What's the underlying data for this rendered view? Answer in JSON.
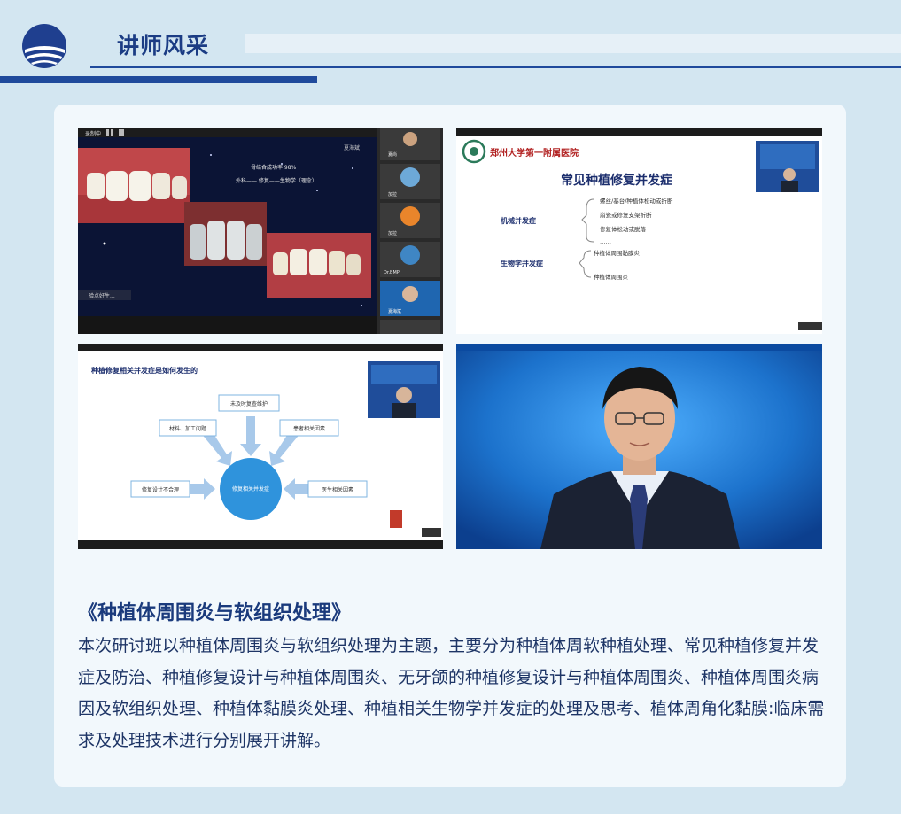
{
  "header": {
    "section_title": "讲师风采"
  },
  "screenshots": {
    "s1": {
      "recording_label": "录制中",
      "slide_line1": "骨结合成功率 98%",
      "slide_line2": "外科—— 修复——生物学（理念）",
      "author_stamp": "夏海斌",
      "caption": "验点好生...",
      "participants": [
        "夏尚",
        "加拉",
        "加拉",
        "Dr.BMP",
        "夏海斌"
      ]
    },
    "s2": {
      "hospital_name": "郑州大学第一附属医院",
      "slide_title": "常见种植修复并发症",
      "group1_label": "机械并发症",
      "group1_items": [
        "螺丝/基台/种植体松动或折断",
        "崩瓷或修复支架折断",
        "修复体松动或脱落",
        "……"
      ],
      "group2_label": "生物学并发症",
      "group2_items": [
        "种植体周围黏膜炎",
        "种植体周围炎"
      ]
    },
    "s3": {
      "slide_title": "种植修复相关并发症是如何发生的",
      "center_label": "修复相关并发症",
      "nodes": [
        "未及时复查维护",
        "材料、加工问题",
        "患者相关因素",
        "修复设计不合理",
        "医生相关因素"
      ]
    }
  },
  "talk": {
    "title": "《种植体周围炎与软组织处理》",
    "description": "本次研讨班以种植体周围炎与软组织处理为主题，主要分为种植体周软种植处理、常见种植修复并发症及防治、种植修复设计与种植体周围炎、无牙颌的种植修复设计与种植体周围炎、种植体周围炎病因及软组织处理、种植体黏膜炎处理、种植相关生物学并发症的处理及思考、植体周角化黏膜:临床需求及处理技术进行分别展开讲解。"
  },
  "colors": {
    "page_bg": "#d3e6f1",
    "brand_blue": "#1f4a9c",
    "title_text": "#1b3c84",
    "body_text": "#1e3566"
  }
}
